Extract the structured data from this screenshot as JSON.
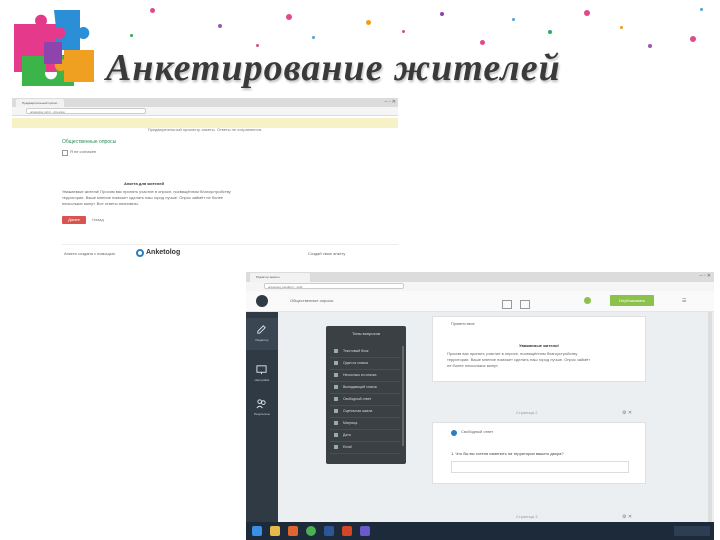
{
  "slide": {
    "title": "Анкетирование жителей",
    "logo_icon": "puzzle-pieces-logo"
  },
  "survey_page": {
    "browser_tab_label": "Предварительный просм…",
    "address_url": "anketolog.ru/rs/…/preview",
    "preview_banner": "Предварительный просмотр анкеты. Ответы не сохраняются.",
    "welcome_heading": "Общественные опросы",
    "checkbox_label": "Я не согласен",
    "section_heading": "Анкета для жителей",
    "paragraph_lines": [
      "Уважаемые жители! Просим вас принять участие в опросе, посвящённом благоустройству",
      "территории. Ваше мнение поможет сделать наш город лучше. Опрос займёт не более",
      "нескольких минут. Все ответы анонимны."
    ],
    "next_button": "Далее",
    "back_link": "Назад",
    "footer_left": "Анкета создана с помощью",
    "brand_name": "Anketolog",
    "footer_right": "Создай свою анкету"
  },
  "editor_page": {
    "browser_tab_label": "Редактор анкеты",
    "address_url": "anketolog.ru/editor/…/edit",
    "survey_name": "Общественные опросы",
    "publish_button": "Опубликовать",
    "sidebar": [
      {
        "label": "Редактор",
        "icon": "pencil-icon"
      },
      {
        "label": "Настройки",
        "icon": "monitor-icon"
      },
      {
        "label": "Результаты",
        "icon": "people-icon"
      }
    ],
    "palette_title": "Типы вопросов",
    "palette_items": [
      "Текстовый блок",
      "Один из списка",
      "Несколько из списка",
      "Выпадающий список",
      "Свободный ответ",
      "Оценочная шкала",
      "Матрица",
      "Дата",
      "Email"
    ],
    "card1_label": "Приветствие",
    "card1_heading": "Уважаемые жители!",
    "card1_lines": [
      "Просим вас принять участие в опросе, посвящённом благоустройству",
      "территории. Ваше мнение поможет сделать наш город лучше. Опрос займёт",
      "не более нескольких минут."
    ],
    "divider1": "Страница 2",
    "card2_label": "Свободный ответ",
    "card2_question": "1. Что бы вы хотели изменить на территории вашего двора?",
    "divider2": "Страница 3"
  },
  "colors": {
    "accent_green": "#8bc34a",
    "accent_red": "#d9534f",
    "sidebar_dark": "#2f3a44",
    "palette_dark": "#3b4045",
    "banner_yellow": "#f7f2c6"
  }
}
